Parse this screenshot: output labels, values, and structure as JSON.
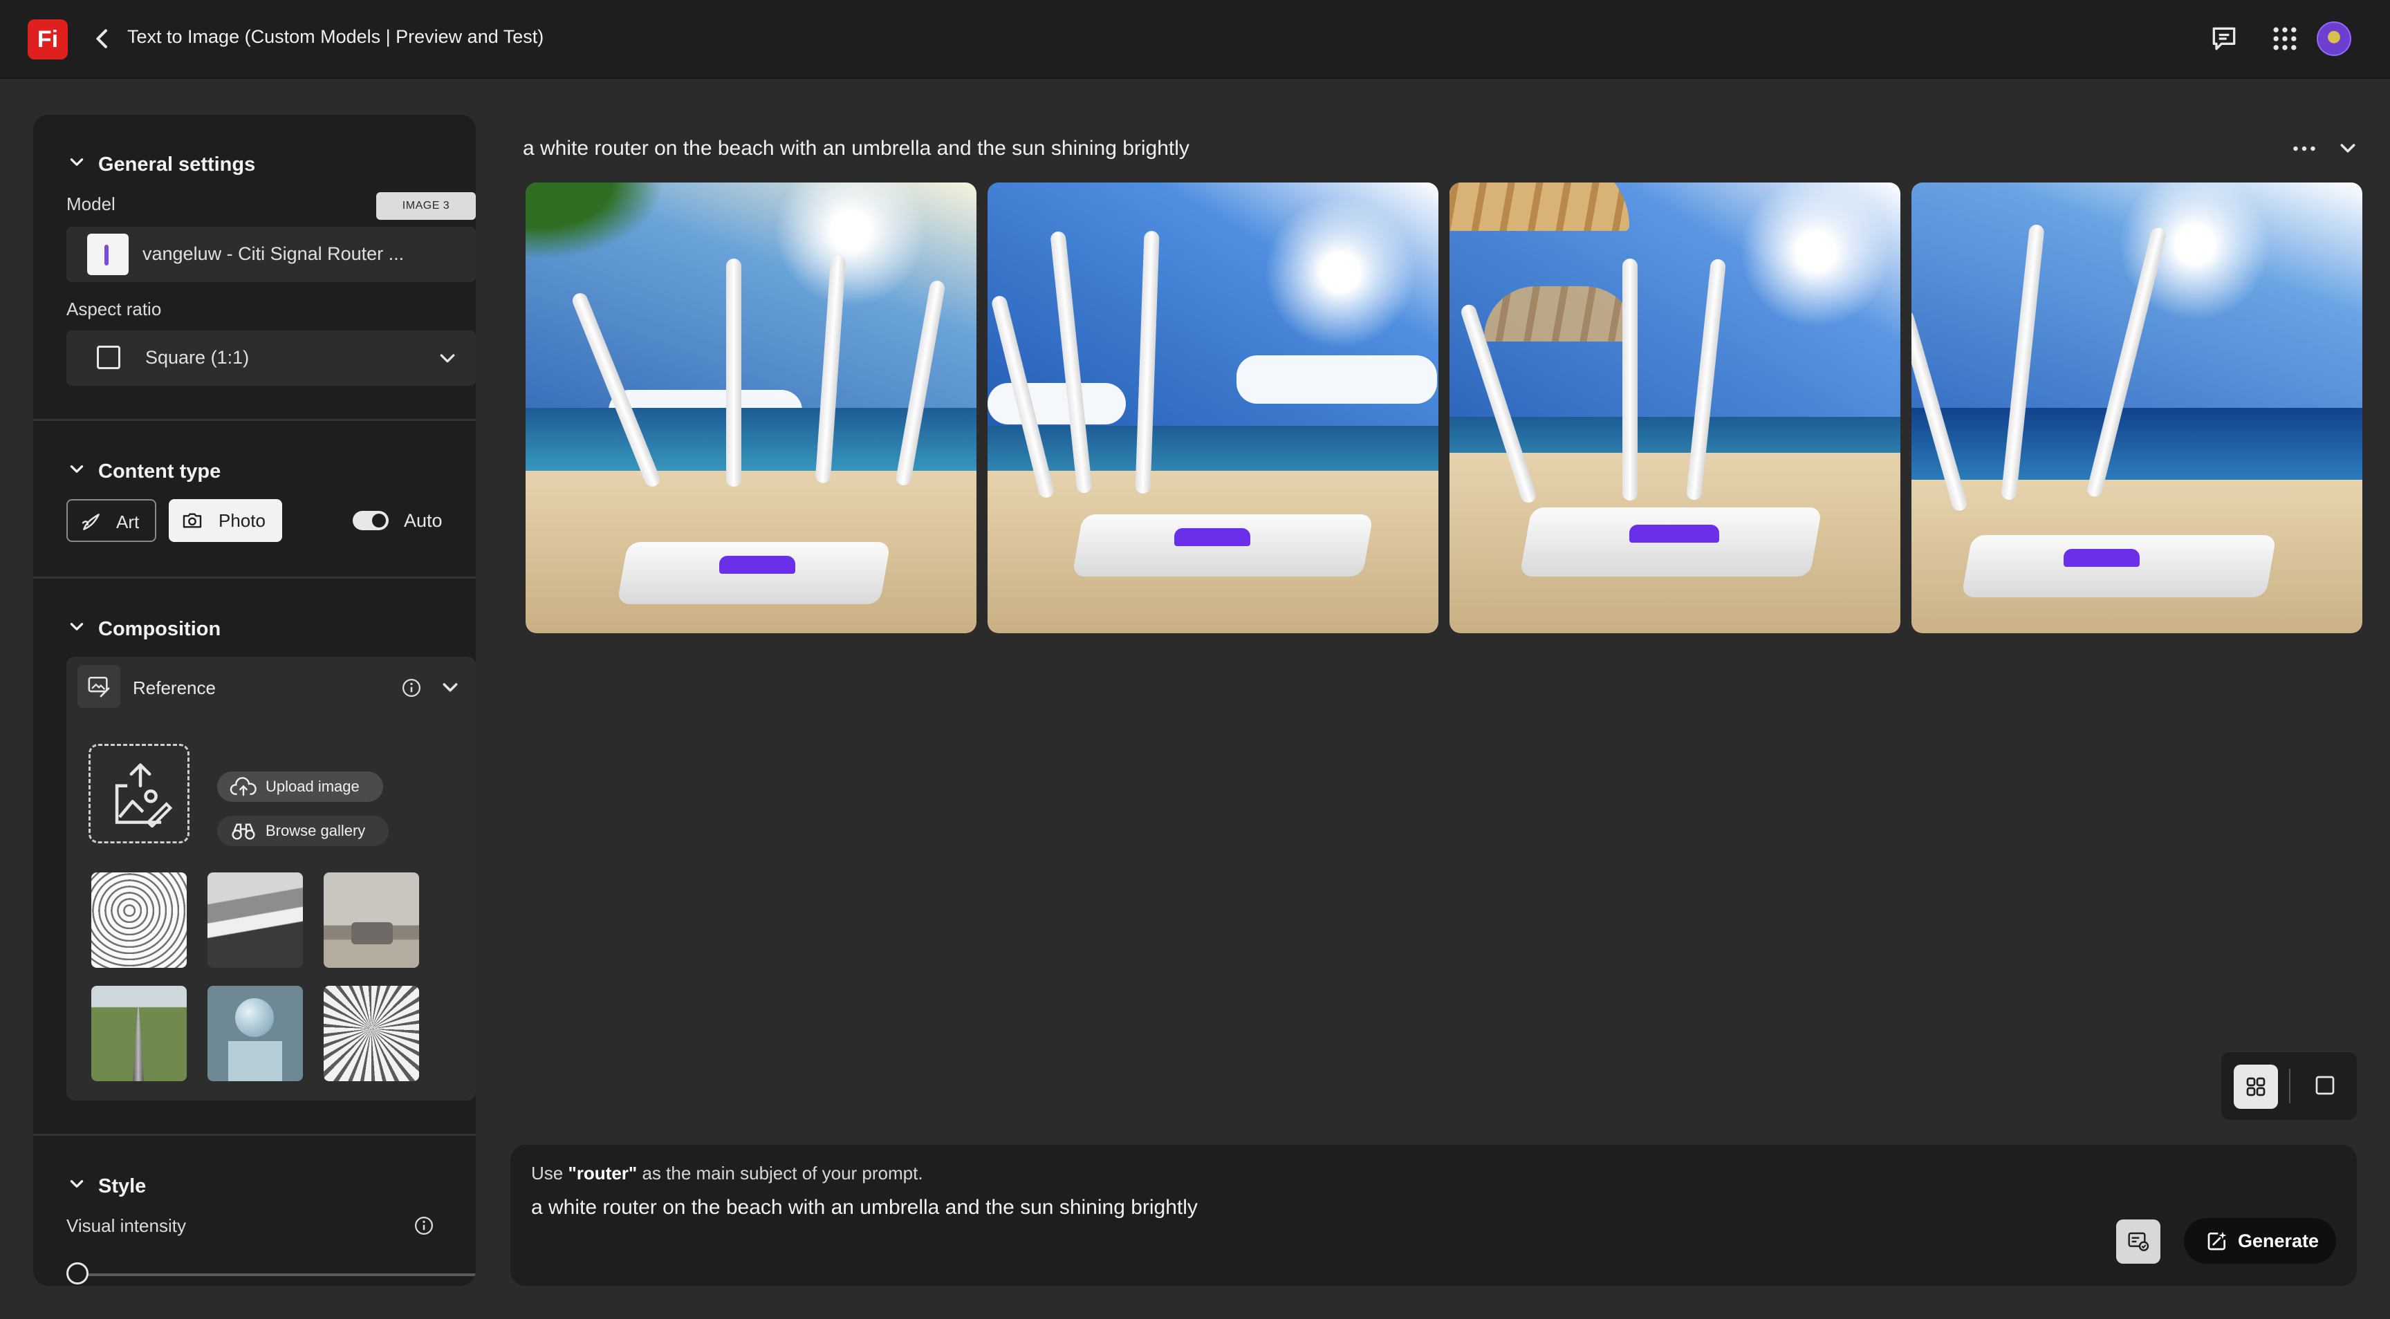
{
  "app": {
    "logo_text": "Fi",
    "title": "Text to Image (Custom Models | Preview and Test)",
    "accent_color": "#e0201f"
  },
  "topbar_icons": [
    "back-chevron-icon",
    "chat-icon",
    "apps-grid-icon",
    "avatar"
  ],
  "sidebar": {
    "general": {
      "title": "General settings",
      "model_label": "Model",
      "model_badge": "IMAGE 3",
      "model_value": "vangeluw - Citi Signal Router ...",
      "aspect_label": "Aspect ratio",
      "aspect_value": "Square (1:1)"
    },
    "content_type": {
      "title": "Content type",
      "art_label": "Art",
      "photo_label": "Photo",
      "selected": "Photo",
      "auto_label": "Auto",
      "auto_on": true
    },
    "composition": {
      "title": "Composition",
      "reference_label": "Reference",
      "upload_label": "Upload image",
      "browse_label": "Browse gallery",
      "thumbnail_count": 6
    },
    "style": {
      "title": "Style",
      "intensity_label": "Visual intensity",
      "intensity_value": 0
    }
  },
  "main": {
    "prompt_heading": "a white router on the beach with an umbrella and the sun shining brightly",
    "result_count": 4,
    "view_mode": "grid"
  },
  "prompt_bar": {
    "hint_prefix": "Use ",
    "hint_subject": "\"router\"",
    "hint_suffix": " as the main subject of your prompt.",
    "prompt_value": "a white router on the beach with an umbrella and the sun shining brightly",
    "generate_label": "Generate"
  }
}
